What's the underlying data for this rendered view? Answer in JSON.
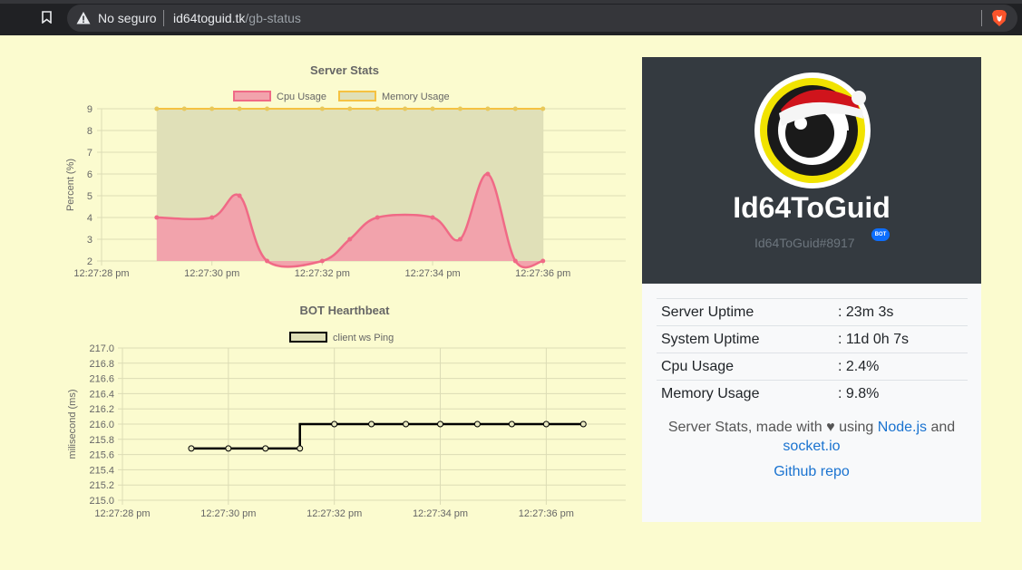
{
  "browser": {
    "insecure_label": "No seguro",
    "url_host": "id64toguid.tk",
    "url_path": "/gb-status",
    "icons": [
      "bookmark-icon",
      "warning-icon",
      "brave-icon"
    ]
  },
  "chart_data": [
    {
      "type": "line",
      "title": "Server Stats",
      "categories": [
        "12:27:28 pm",
        "12:27:30 pm",
        "12:27:32 pm",
        "12:27:34 pm",
        "12:27:36 pm"
      ],
      "x": [
        28.0,
        29.0,
        29.5,
        30.0,
        30.5,
        31.0,
        32.0,
        32.5,
        33.0,
        33.5,
        34.0,
        34.5,
        35.0,
        35.5,
        36.0,
        36.5,
        37.0
      ],
      "series": [
        {
          "name": "Cpu Usage",
          "color": "#f06a86",
          "fill": "#f2a3ac",
          "values": [
            null,
            4,
            null,
            4,
            5,
            2,
            2,
            3,
            4,
            null,
            4,
            3,
            6,
            2,
            2,
            null,
            null
          ]
        },
        {
          "name": "Memory Usage",
          "color": "#f5c242",
          "fill": "#e0e0b8",
          "values": [
            null,
            9,
            9,
            9,
            9,
            9,
            9,
            9,
            9,
            9,
            9,
            9,
            9,
            9,
            9,
            null,
            null
          ]
        }
      ],
      "ylabel": "Percent (%)",
      "ylim": [
        2,
        9
      ],
      "yticks": [
        "9",
        "8",
        "7",
        "6",
        "5",
        "4",
        "3",
        "2"
      ]
    },
    {
      "type": "line",
      "title": "BOT Hearthbeat",
      "categories": [
        "12:27:28 pm",
        "12:27:30 pm",
        "12:27:32 pm",
        "12:27:34 pm",
        "12:27:36 pm"
      ],
      "series": [
        {
          "name": "client ws Ping",
          "color": "#000000",
          "values": [
            215.68,
            215.68,
            215.68,
            215.68,
            216.0,
            216.0,
            216.0,
            216.0,
            216.0,
            216.0,
            216.0,
            216.0
          ]
        }
      ],
      "ylabel": "milisecond (ms)",
      "ylim": [
        215.0,
        217.0
      ],
      "yticks": [
        "217.0",
        "216.8",
        "216.6",
        "216.4",
        "216.2",
        "216.0",
        "215.8",
        "215.6",
        "215.4",
        "215.2",
        "215.0"
      ]
    }
  ],
  "card": {
    "bot_name": "Id64ToGuid",
    "bot_tag": "Id64ToGuid#8917",
    "bot_badge": "BOT",
    "stats": [
      {
        "label": "Server Uptime",
        "value": ": 23m 3s"
      },
      {
        "label": "System Uptime",
        "value": ": 11d 0h 7s"
      },
      {
        "label": "Cpu Usage",
        "value": ": 2.4%"
      },
      {
        "label": "Memory Usage",
        "value": ": 9.8%"
      }
    ],
    "footer_prefix": "Server Stats, made with",
    "footer_heart": "♥",
    "footer_using": "using",
    "footer_link1": "Node.js",
    "footer_and": "and",
    "footer_link2": "socket.io",
    "repo_link": "Github repo"
  }
}
